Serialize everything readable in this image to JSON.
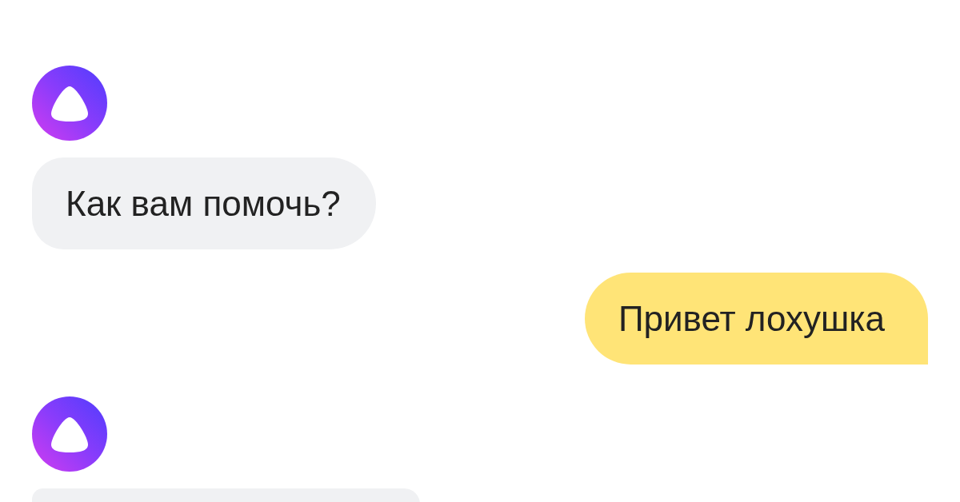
{
  "messages": [
    {
      "kind": "assistant",
      "text": "Как вам помочь?"
    },
    {
      "kind": "user",
      "text": "Привет лохушка"
    },
    {
      "kind": "assistant"
    }
  ]
}
